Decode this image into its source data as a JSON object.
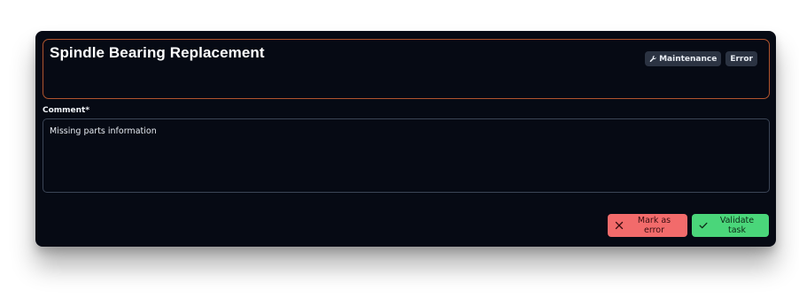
{
  "task": {
    "title": "Spindle Bearing Replacement",
    "tags": [
      {
        "label": "Maintenance",
        "icon": "wrench-icon"
      },
      {
        "label": "Error"
      }
    ]
  },
  "comment": {
    "label": "Comment*",
    "value": "Missing parts information"
  },
  "actions": {
    "error_label": "Mark as error",
    "validate_label": "Validate task"
  },
  "colors": {
    "card_bg": "#060a14",
    "header_border": "#b0542e",
    "error_button": "#f26b6b",
    "validate_button": "#4ad67a",
    "tag_bg": "#2b3342"
  }
}
